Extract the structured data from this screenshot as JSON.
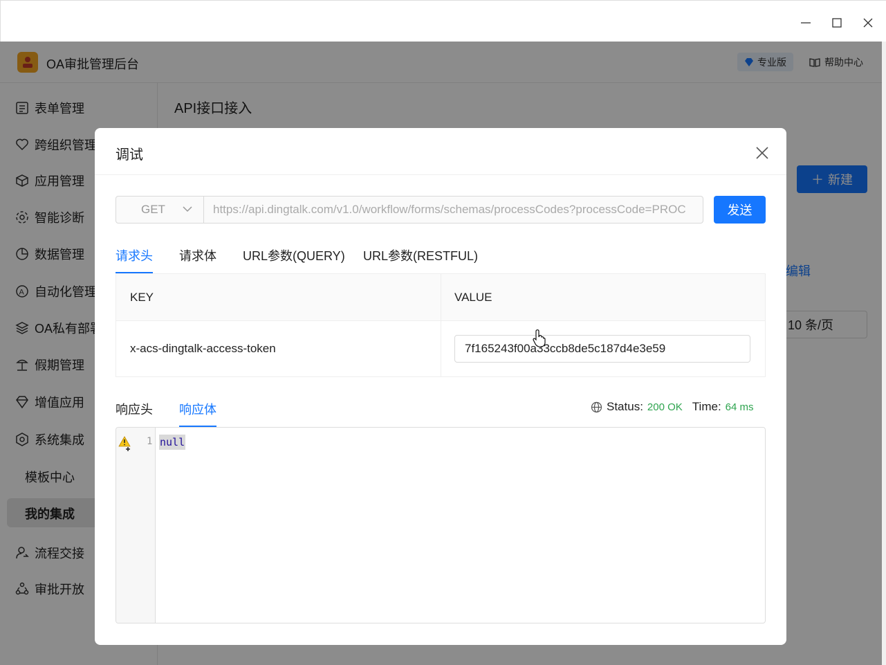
{
  "window": {
    "minimize": "—",
    "maximize": "☐",
    "close": "✕"
  },
  "app": {
    "title": "OA审批管理后台",
    "pro_badge": "专业版",
    "help": "帮助中心"
  },
  "sidebar": {
    "items": [
      {
        "label": "表单管理",
        "icon": "form-icon"
      },
      {
        "label": "跨组织管理",
        "icon": "heart-icon"
      },
      {
        "label": "应用管理",
        "icon": "cube-icon"
      },
      {
        "label": "智能诊断",
        "icon": "diagnosis-icon"
      },
      {
        "label": "数据管理",
        "icon": "pie-icon"
      },
      {
        "label": "自动化管理",
        "icon": "automation-icon"
      },
      {
        "label": "OA私有部署",
        "icon": "layers-icon"
      },
      {
        "label": "假期管理",
        "icon": "beach-icon"
      },
      {
        "label": "增值应用",
        "icon": "diamond-icon"
      },
      {
        "label": "系统集成",
        "icon": "integration-icon"
      }
    ],
    "sub_items": [
      {
        "label": "模板中心"
      },
      {
        "label": "我的集成"
      }
    ],
    "bottom_items": [
      {
        "label": "流程交接",
        "icon": "handover-icon"
      },
      {
        "label": "审批开放",
        "icon": "share-icon"
      }
    ]
  },
  "content": {
    "title": "API接口接入",
    "new_button": "新建",
    "edit_link": "编辑",
    "page_size": "10 条/页"
  },
  "modal": {
    "title": "调试",
    "method": "GET",
    "url": "https://api.dingtalk.com/v1.0/workflow/forms/schemas/processCodes?processCode=PROC",
    "send": "发送",
    "request_tabs": [
      "请求头",
      "请求体",
      "URL参数(QUERY)",
      "URL参数(RESTFUL)"
    ],
    "active_request_tab": "请求头",
    "table": {
      "key_header": "KEY",
      "value_header": "VALUE",
      "rows": [
        {
          "key": "x-acs-dingtalk-access-token",
          "value": "7f165243f00a33ccb8de5c187d4e3e59"
        }
      ]
    },
    "response_tabs": [
      "响应头",
      "响应体"
    ],
    "active_response_tab": "响应体",
    "status_label": "Status:",
    "status_value": "200 OK",
    "time_label": "Time:",
    "time_value": "64 ms",
    "editor": {
      "line_number": "1",
      "code": "null"
    }
  },
  "colors": {
    "primary": "#1677ff",
    "success": "#2ea44f"
  }
}
